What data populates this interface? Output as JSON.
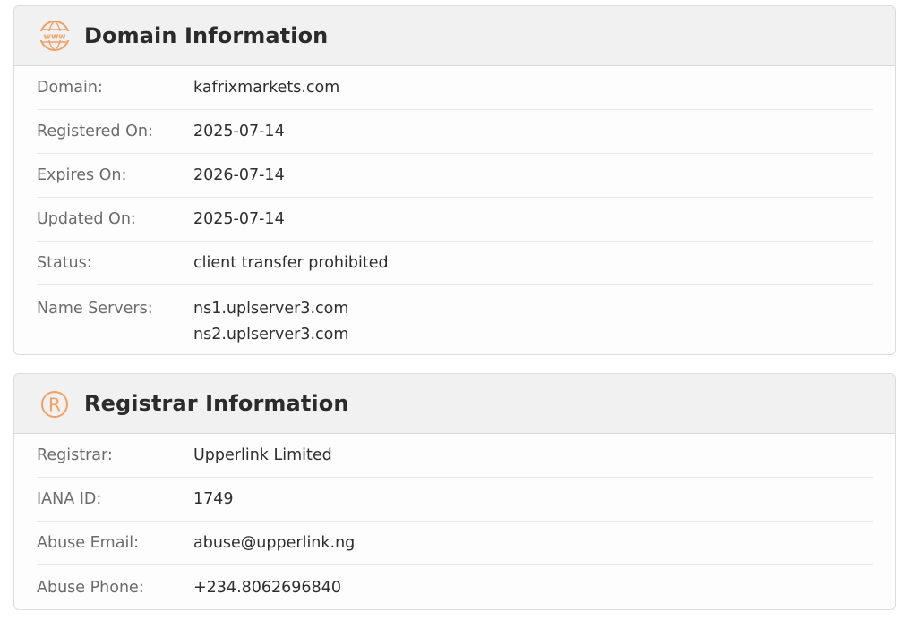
{
  "domain_section": {
    "title": "Domain Information",
    "icon": "www-globe-icon",
    "rows": [
      {
        "label": "Domain:",
        "value": "kafrixmarkets.com"
      },
      {
        "label": "Registered On:",
        "value": "2025-07-14"
      },
      {
        "label": "Expires On:",
        "value": "2026-07-14"
      },
      {
        "label": "Updated On:",
        "value": "2025-07-14"
      },
      {
        "label": "Status:",
        "value": "client transfer prohibited"
      }
    ],
    "name_servers": {
      "label": "Name Servers:",
      "values": [
        "ns1.uplserver3.com",
        "ns2.uplserver3.com"
      ]
    }
  },
  "registrar_section": {
    "title": "Registrar Information",
    "icon": "registered-icon",
    "rows": [
      {
        "label": "Registrar:",
        "value": "Upperlink Limited"
      },
      {
        "label": "IANA ID:",
        "value": "1749"
      },
      {
        "label": "Abuse Email:",
        "value": "abuse@upperlink.ng"
      },
      {
        "label": "Abuse Phone:",
        "value": "+234.8062696840"
      }
    ]
  },
  "colors": {
    "accent": "#f4a060",
    "header_bg": "#f1f1f1",
    "label": "#6b6b6b",
    "value": "#2e2e2e"
  }
}
